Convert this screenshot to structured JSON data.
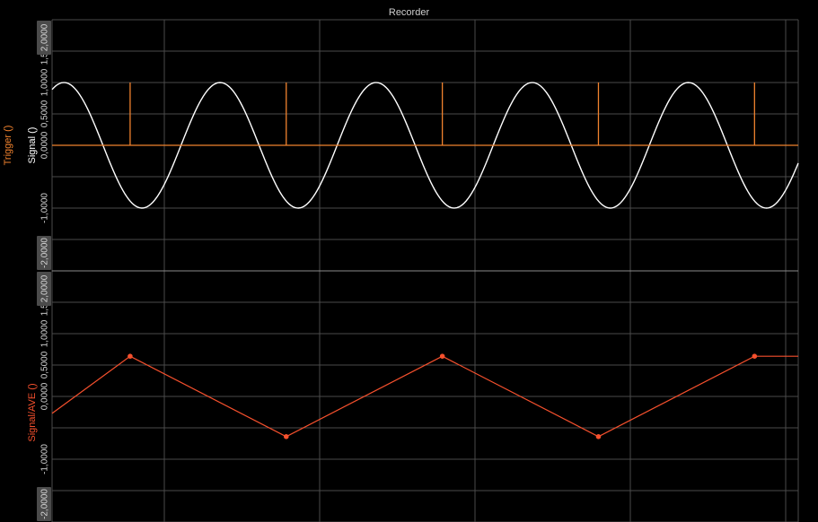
{
  "window": {
    "title": "Recorder"
  },
  "colors": {
    "background": "#000000",
    "grid": "#4a4a4a",
    "signal": "#ffffff",
    "trigger": "#f0822e",
    "average": "#f5502d",
    "tick_text": "#d6d6d6",
    "badge": "#4b4b4b"
  },
  "chart_data": [
    {
      "type": "line",
      "title": "Recorder",
      "y_labels": [
        "Trigger ()",
        "Signal ()"
      ],
      "ylim": [
        -2,
        2
      ],
      "xlim": [
        0,
        2.39
      ],
      "y_ticks": [
        "-2,0000",
        "-1,0000",
        "0,0000",
        "0,5000",
        "1,0000",
        "1,5000",
        "2,0000"
      ],
      "y_tick_values": [
        -2,
        -1,
        0,
        0.5,
        1,
        1.5,
        2
      ],
      "highlighted_ticks": [
        "2,0000",
        "-2,0000"
      ],
      "grid": true,
      "series": [
        {
          "name": "Signal ()",
          "color": "#ffffff",
          "function": "sine",
          "amplitude": 1.0,
          "period": 0.5,
          "phase_offset": -0.087,
          "x_start": 0,
          "x_end": 2.39
        },
        {
          "name": "Trigger ()",
          "color": "#f0822e",
          "baseline": 0,
          "pulse_height": 1.0,
          "pulse_x": [
            0.25,
            0.75,
            1.25,
            1.75,
            2.25
          ]
        }
      ]
    },
    {
      "type": "line",
      "y_labels": [
        "Signal/AVE ()"
      ],
      "ylim": [
        -2,
        2
      ],
      "xlim": [
        0,
        2.39
      ],
      "y_ticks": [
        "-2,0000",
        "-1,0000",
        "0,0000",
        "0,5000",
        "1,0000",
        "1,5000",
        "2,0000"
      ],
      "y_tick_values": [
        -2,
        -1,
        0,
        0.5,
        1,
        1.5,
        2
      ],
      "highlighted_ticks": [
        "2,0000",
        "-2,0000"
      ],
      "grid": true,
      "series": [
        {
          "name": "Signal/AVE ()",
          "color": "#f5502d",
          "points": [
            {
              "x": 0.0,
              "y": -0.27
            },
            {
              "x": 0.25,
              "y": 0.64,
              "marker": true
            },
            {
              "x": 0.75,
              "y": -0.64,
              "marker": true
            },
            {
              "x": 1.25,
              "y": 0.64,
              "marker": true
            },
            {
              "x": 1.75,
              "y": -0.64,
              "marker": true
            },
            {
              "x": 2.25,
              "y": 0.64,
              "marker": true
            },
            {
              "x": 2.39,
              "y": 0.64
            }
          ]
        }
      ]
    }
  ]
}
